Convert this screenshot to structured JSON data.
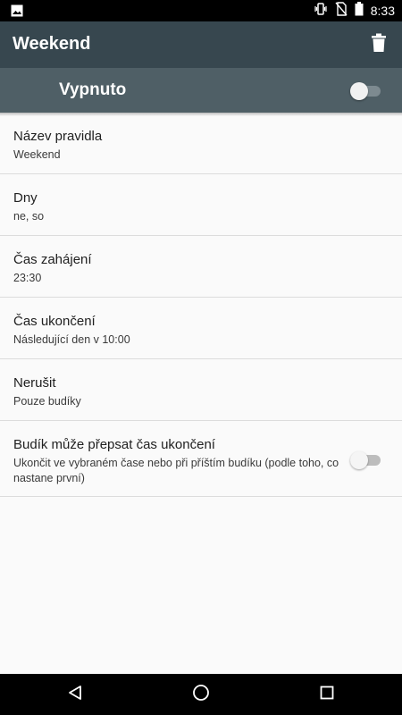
{
  "status_bar": {
    "time": "8:33",
    "icons": [
      "image-icon",
      "vibrate-icon",
      "no-sim-icon",
      "battery-icon"
    ]
  },
  "app_bar": {
    "title": "Weekend",
    "delete_icon": "trash-icon"
  },
  "master": {
    "label": "Vypnuto",
    "switch_on": false
  },
  "settings": [
    {
      "title": "Název pravidla",
      "subtitle": "Weekend"
    },
    {
      "title": "Dny",
      "subtitle": "ne, so"
    },
    {
      "title": "Čas zahájení",
      "subtitle": "23:30"
    },
    {
      "title": "Čas ukončení",
      "subtitle": "Následující den v 10:00"
    },
    {
      "title": "Nerušit",
      "subtitle": "Pouze budíky"
    },
    {
      "title": "Budík může přepsat čas ukončení",
      "subtitle": "Ukončit ve vybraném čase nebo při příštím budíku (podle toho, co nastane první)",
      "switch_on": false
    }
  ],
  "nav_bar": {
    "icons": [
      "back-icon",
      "home-icon",
      "recents-icon"
    ]
  },
  "colors": {
    "app_bar": "#37474f",
    "master_bar": "#4f5f66",
    "background": "#fafafa"
  }
}
